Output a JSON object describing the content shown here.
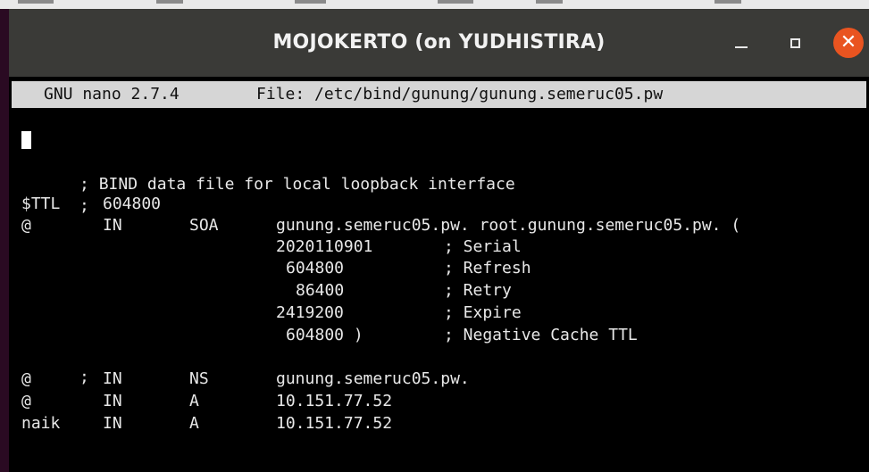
{
  "window": {
    "title": "MOJOKERTO (on YUDHISTIRA)",
    "close_glyph": "✕",
    "accent_close": "#e95420",
    "titlebar_color": "#3a3a37"
  },
  "nano": {
    "version": "GNU nano 2.7.4",
    "file": "File: /etc/bind/gunung/gunung.semeruc05.pw"
  },
  "file_lines": {
    "l1": ";",
    "l2": "; BIND data file for local loopback interface",
    "l3": ";",
    "ttl": {
      "directive": "$TTL",
      "value": "604800"
    },
    "soa": {
      "name": "@",
      "class": "IN",
      "type": "SOA",
      "rdata": "gunung.semeruc05.pw. root.gunung.semeruc05.pw. ("
    },
    "serial": {
      "value": "2020110901",
      "comment": "; Serial"
    },
    "refresh": {
      "value": "604800",
      "comment": "; Refresh"
    },
    "retry": {
      "value": "86400",
      "comment": "; Retry"
    },
    "expire": {
      "value": "2419200",
      "comment": "; Expire"
    },
    "negcache": {
      "value": "604800 )",
      "comment": "; Negative Cache TTL"
    },
    "l4": ";",
    "records": [
      {
        "name": "@",
        "class": "IN",
        "type": "NS",
        "data": "gunung.semeruc05.pw."
      },
      {
        "name": "@",
        "class": "IN",
        "type": "A",
        "data": "10.151.77.52"
      },
      {
        "name": "naik",
        "class": "IN",
        "type": "A",
        "data": "10.151.77.52"
      }
    ]
  }
}
